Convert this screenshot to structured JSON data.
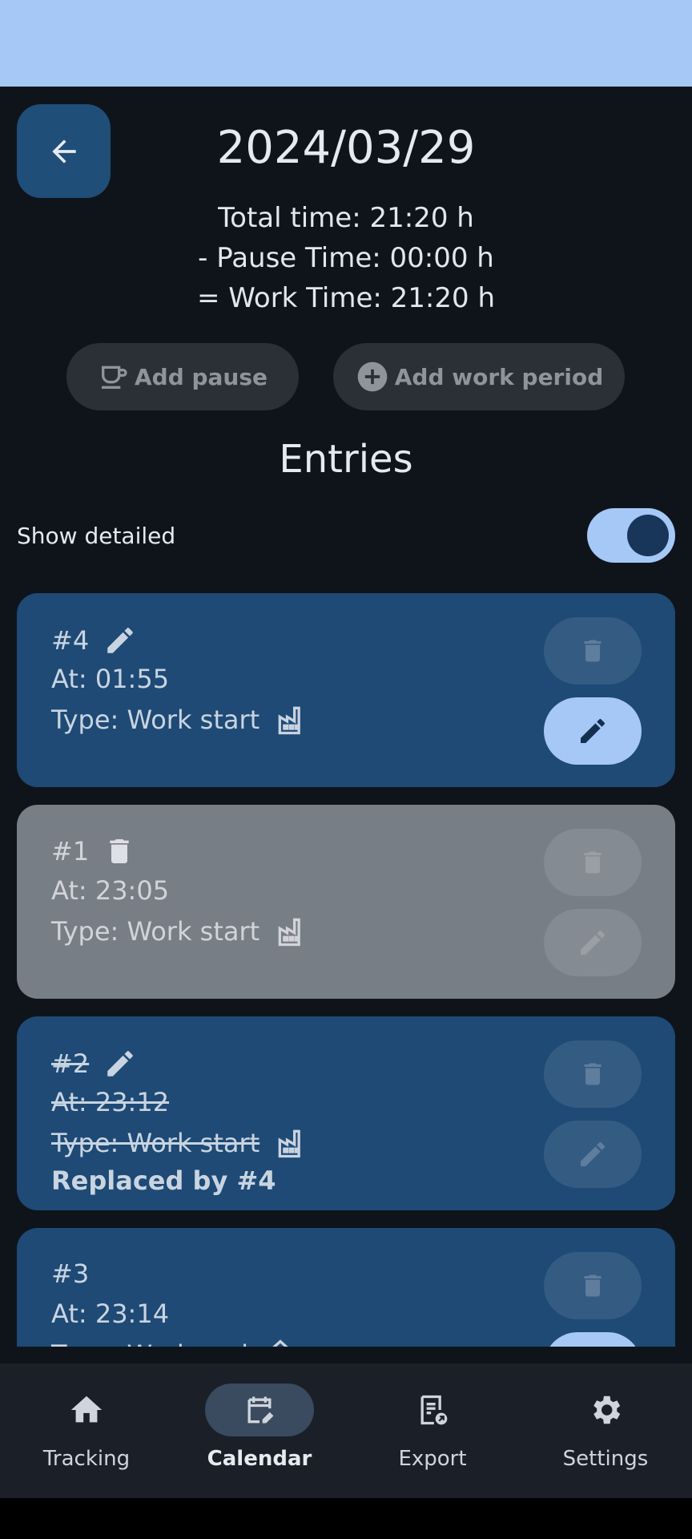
{
  "header": {
    "date_title": "2024/03/29",
    "total_time": "Total time: 21:20 h",
    "pause_time": "- Pause Time: 00:00 h",
    "work_time": "= Work Time: 21:20 h"
  },
  "actions": {
    "add_pause": "Add pause",
    "add_work_period": "Add work period"
  },
  "entries": {
    "title": "Entries",
    "show_detailed_label": "Show detailed",
    "show_detailed_on": true,
    "items": [
      {
        "id": "#4",
        "at": "At: 01:55",
        "type": "Type: Work start",
        "state": "edited",
        "status_icon": "pencil-icon",
        "type_icon": "factory-icon"
      },
      {
        "id": "#1",
        "at": "At: 23:05",
        "type": "Type: Work start",
        "state": "deleted",
        "status_icon": "trash-icon",
        "type_icon": "factory-icon"
      },
      {
        "id": "#2",
        "at": "At: 23:12",
        "type": "Type: Work start",
        "state": "replaced",
        "status_icon": "pencil-icon",
        "type_icon": "factory-icon",
        "note": "Replaced by #4"
      },
      {
        "id": "#3",
        "at": "At: 23:14",
        "type": "Type: Work end",
        "state": "normal",
        "type_icon": "home-icon"
      }
    ]
  },
  "nav": {
    "items": [
      {
        "label": "Tracking",
        "icon": "home-icon"
      },
      {
        "label": "Calendar",
        "icon": "calendar-edit-icon",
        "active": true
      },
      {
        "label": "Export",
        "icon": "export-icon"
      },
      {
        "label": "Settings",
        "icon": "gear-icon"
      }
    ]
  },
  "colors": {
    "status_bar": "#a6c8f7",
    "background": "#0f141b",
    "card": "#1e4a75",
    "card_deleted": "#787e86",
    "accent": "#a6c8f7"
  }
}
